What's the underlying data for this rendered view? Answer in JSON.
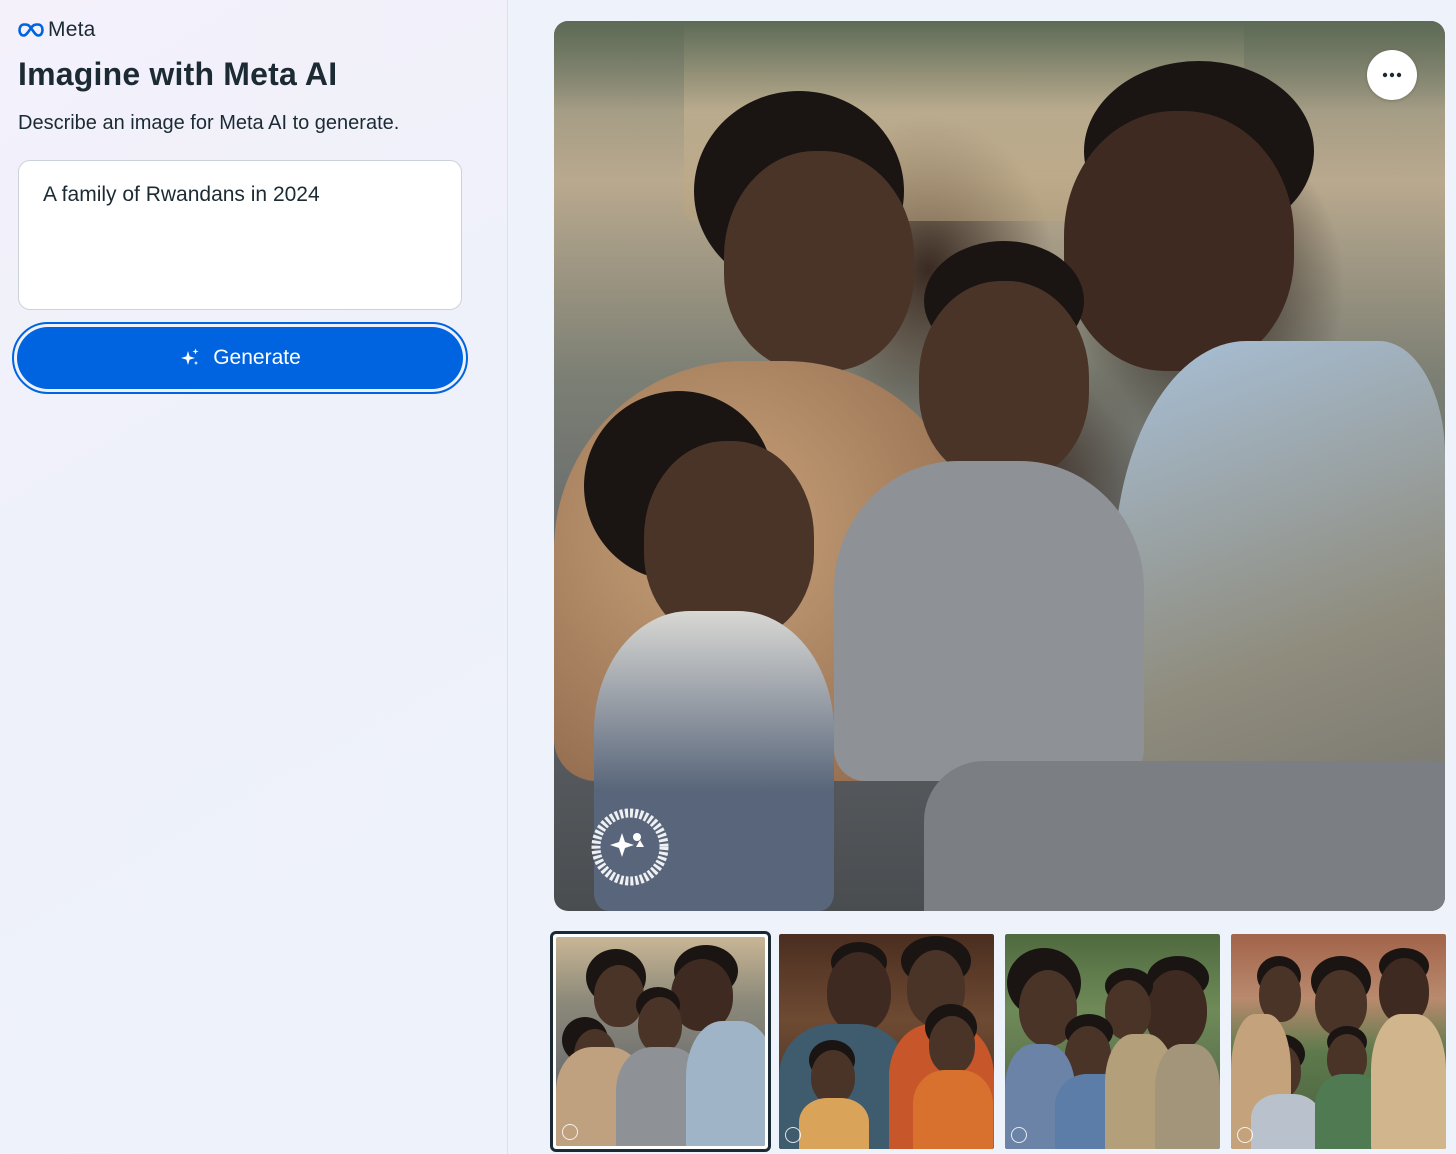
{
  "brand": {
    "name": "Meta",
    "logo_icon": "meta-infinity-logo"
  },
  "header": {
    "title": "Imagine with Meta AI",
    "subtitle": "Describe an image for Meta AI to generate."
  },
  "prompt": {
    "value": "A family of Rwandans in 2024"
  },
  "generate": {
    "label": "Generate",
    "icon": "sparkle-icon"
  },
  "main_image": {
    "alt": "A family of Rwandans in 2024",
    "more_icon": "more-horizontal-icon",
    "watermark_text": "IMAGINED WITH AI · IMAGINED WITH AI"
  },
  "thumbnails": [
    {
      "alt": "Generated image 1",
      "selected": true
    },
    {
      "alt": "Generated image 2",
      "selected": false
    },
    {
      "alt": "Generated image 3",
      "selected": false
    },
    {
      "alt": "Generated image 4",
      "selected": false
    }
  ],
  "colors": {
    "accent": "#0064e0",
    "text": "#1c2b33",
    "panel": "#eef2fa"
  }
}
